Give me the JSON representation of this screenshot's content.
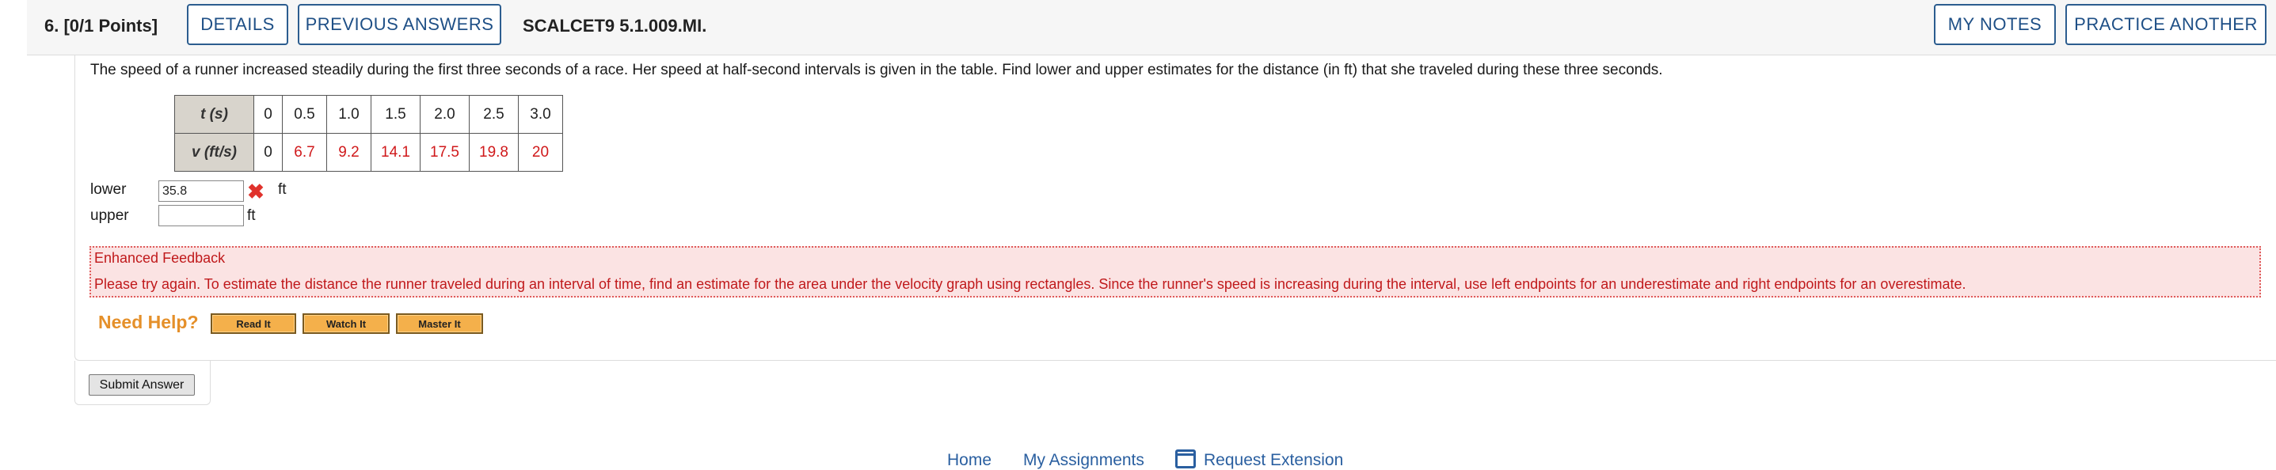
{
  "header": {
    "question_number": "6.",
    "points": "[0/1 Points]",
    "details_label": "DETAILS",
    "previous_answers_label": "PREVIOUS ANSWERS",
    "code": "SCALCET9 5.1.009.MI.",
    "my_notes_label": "MY NOTES",
    "practice_another_label": "PRACTICE ANOTHER"
  },
  "question": {
    "prompt": "The speed of a runner increased steadily during the first three seconds of a race. Her speed at half-second intervals is given in the table. Find lower and upper estimates for the distance (in ft) that she traveled during these three seconds."
  },
  "table": {
    "row1_header": "t (s)",
    "row1_values": [
      "0",
      "0.5",
      "1.0",
      "1.5",
      "2.0",
      "2.5",
      "3.0"
    ],
    "row2_header": "v (ft/s)",
    "row2_values": [
      "0",
      "6.7",
      "9.2",
      "14.1",
      "17.5",
      "19.8",
      "20"
    ],
    "value_color": "#d0191b"
  },
  "answers": {
    "lower_label": "lower",
    "lower_value": "35.8",
    "lower_unit": "ft",
    "lower_status_icon": "incorrect-x-icon",
    "upper_label": "upper",
    "upper_value": "",
    "upper_unit": "ft"
  },
  "feedback": {
    "title": "Enhanced Feedback",
    "text": "Please try again. To estimate the distance the runner traveled during an interval of time, find an estimate for the area under the velocity graph using rectangles. Since the runner's speed is increasing during the interval, use left endpoints for an underestimate and right endpoints for an overestimate."
  },
  "help": {
    "title": "Need Help?",
    "read_it": "Read It",
    "watch_it": "Watch It",
    "master_it": "Master It"
  },
  "submit_label": "Submit Answer",
  "footer": {
    "home": "Home",
    "my_assignments": "My Assignments",
    "request_extension": "Request Extension"
  },
  "colors": {
    "accent_blue": "#1e4f86",
    "error_red": "#c0191b",
    "help_orange": "#e5902a"
  }
}
